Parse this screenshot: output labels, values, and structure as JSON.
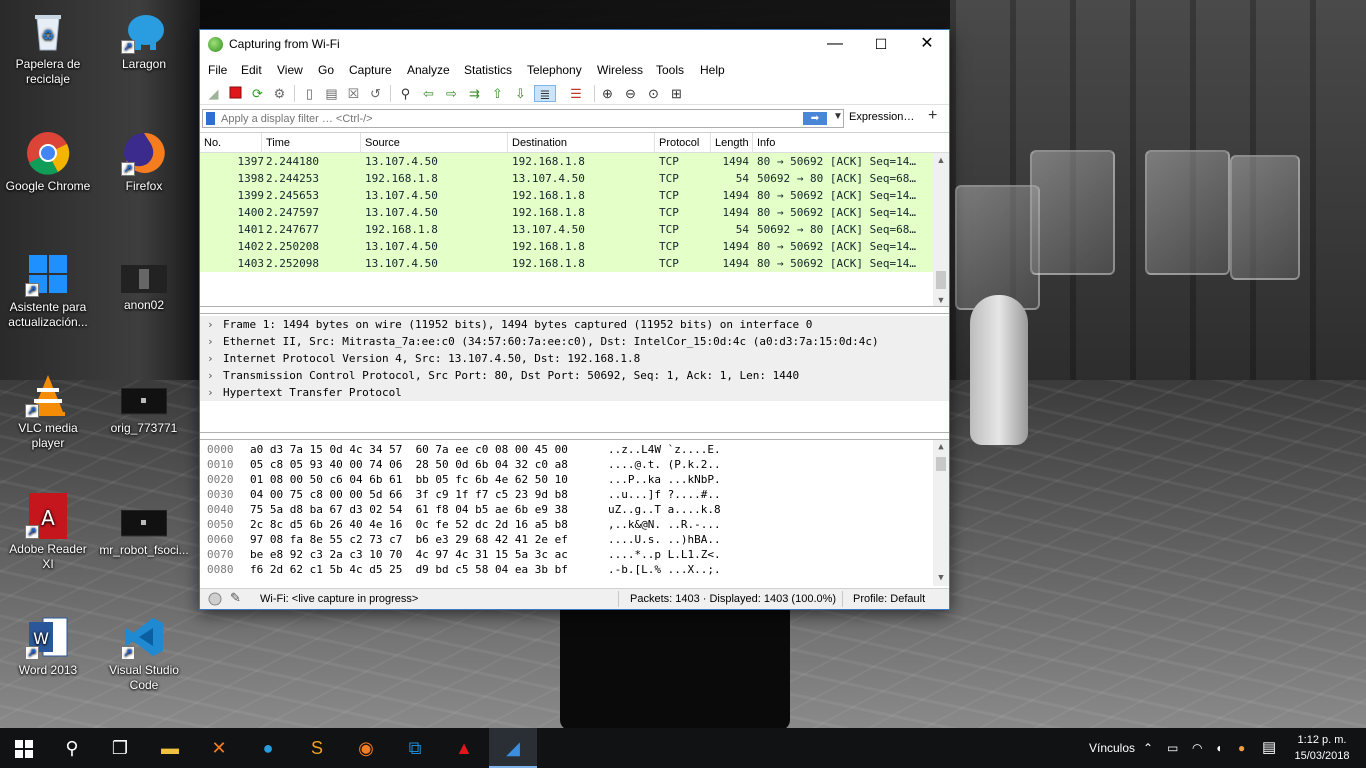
{
  "desktop": {
    "icons": [
      {
        "label": "Papelera de reciclaje",
        "icon": "recycle-bin-icon"
      },
      {
        "label": "Laragon",
        "icon": "laragon-icon"
      },
      {
        "label": "Google Chrome",
        "icon": "chrome-icon"
      },
      {
        "label": "Firefox",
        "icon": "firefox-icon"
      },
      {
        "label": "Asistente para actualización...",
        "icon": "windows-update-icon"
      },
      {
        "label": "anon02",
        "icon": "image-file-icon"
      },
      {
        "label": "VLC media player",
        "icon": "vlc-icon"
      },
      {
        "label": "orig_773771",
        "icon": "image-file-icon"
      },
      {
        "label": "Adobe Reader XI",
        "icon": "adobe-reader-icon"
      },
      {
        "label": "mr_robot_fsoci...",
        "icon": "image-file-icon"
      },
      {
        "label": "Word 2013",
        "icon": "word-icon"
      },
      {
        "label": "Visual Studio Code",
        "icon": "vscode-icon"
      }
    ]
  },
  "window": {
    "title": "Capturing from Wi-Fi",
    "controls": {
      "minimize": "—",
      "maximize": "☐",
      "close": "✕"
    }
  },
  "menu": [
    "File",
    "Edit",
    "View",
    "Go",
    "Capture",
    "Analyze",
    "Statistics",
    "Telephony",
    "Wireless",
    "Tools",
    "Help"
  ],
  "filter": {
    "placeholder": "Apply a display filter … <Ctrl-/>",
    "apply_symbol": "➡",
    "expression_label": "Expression…",
    "add_label": "+"
  },
  "packet_list": {
    "columns": [
      "No.",
      "Time",
      "Source",
      "Destination",
      "Protocol",
      "Length",
      "Info"
    ],
    "rows": [
      {
        "no": "1397",
        "time": "2.244180",
        "src": "13.107.4.50",
        "dst": "192.168.1.8",
        "proto": "TCP",
        "len": "1494",
        "info": "80 → 50692 [ACK] Seq=14…"
      },
      {
        "no": "1398",
        "time": "2.244253",
        "src": "192.168.1.8",
        "dst": "13.107.4.50",
        "proto": "TCP",
        "len": "54",
        "info": "50692 → 80 [ACK] Seq=68…"
      },
      {
        "no": "1399",
        "time": "2.245653",
        "src": "13.107.4.50",
        "dst": "192.168.1.8",
        "proto": "TCP",
        "len": "1494",
        "info": "80 → 50692 [ACK] Seq=14…"
      },
      {
        "no": "1400",
        "time": "2.247597",
        "src": "13.107.4.50",
        "dst": "192.168.1.8",
        "proto": "TCP",
        "len": "1494",
        "info": "80 → 50692 [ACK] Seq=14…"
      },
      {
        "no": "1401",
        "time": "2.247677",
        "src": "192.168.1.8",
        "dst": "13.107.4.50",
        "proto": "TCP",
        "len": "54",
        "info": "50692 → 80 [ACK] Seq=68…"
      },
      {
        "no": "1402",
        "time": "2.250208",
        "src": "13.107.4.50",
        "dst": "192.168.1.8",
        "proto": "TCP",
        "len": "1494",
        "info": "80 → 50692 [ACK] Seq=14…"
      },
      {
        "no": "1403",
        "time": "2.252098",
        "src": "13.107.4.50",
        "dst": "192.168.1.8",
        "proto": "TCP",
        "len": "1494",
        "info": "80 → 50692 [ACK] Seq=14…"
      }
    ],
    "row_color": "#e4ffc7"
  },
  "details": [
    "Frame 1: 1494 bytes on wire (11952 bits), 1494 bytes captured (11952 bits) on interface 0",
    "Ethernet II, Src: Mitrasta_7a:ee:c0 (34:57:60:7a:ee:c0), Dst: IntelCor_15:0d:4c (a0:d3:7a:15:0d:4c)",
    "Internet Protocol Version 4, Src: 13.107.4.50, Dst: 192.168.1.8",
    "Transmission Control Protocol, Src Port: 80, Dst Port: 50692, Seq: 1, Ack: 1, Len: 1440",
    "Hypertext Transfer Protocol"
  ],
  "hex": [
    {
      "offset": "0000",
      "bytes": "a0 d3 7a 15 0d 4c 34 57  60 7a ee c0 08 00 45 00",
      "ascii": "..z..L4W `z....E."
    },
    {
      "offset": "0010",
      "bytes": "05 c8 05 93 40 00 74 06  28 50 0d 6b 04 32 c0 a8",
      "ascii": "....@.t. (P.k.2.."
    },
    {
      "offset": "0020",
      "bytes": "01 08 00 50 c6 04 6b 61  bb 05 fc 6b 4e 62 50 10",
      "ascii": "...P..ka ...kNbP."
    },
    {
      "offset": "0030",
      "bytes": "04 00 75 c8 00 00 5d 66  3f c9 1f f7 c5 23 9d b8",
      "ascii": "..u...]f ?....#.."
    },
    {
      "offset": "0040",
      "bytes": "75 5a d8 ba 67 d3 02 54  61 f8 04 b5 ae 6b e9 38",
      "ascii": "uZ..g..T a....k.8"
    },
    {
      "offset": "0050",
      "bytes": "2c 8c d5 6b 26 40 4e 16  0c fe 52 dc 2d 16 a5 b8",
      "ascii": ",..k&@N. ..R.-..."
    },
    {
      "offset": "0060",
      "bytes": "97 08 fa 8e 55 c2 73 c7  b6 e3 29 68 42 41 2e ef",
      "ascii": "....U.s. ..)hBA.."
    },
    {
      "offset": "0070",
      "bytes": "be e8 92 c3 2a c3 10 70  4c 97 4c 31 15 5a 3c ac",
      "ascii": "....*..p L.L1.Z<."
    },
    {
      "offset": "0080",
      "bytes": "f6 2d 62 c1 5b 4c d5 25  d9 bd c5 58 04 ea 3b bf",
      "ascii": ".-b.[L.% ...X..;."
    }
  ],
  "status": {
    "capture": "Wi-Fi: <live capture in progress>",
    "packets": "Packets: 1403 · Displayed: 1403 (100.0%)",
    "profile": "Profile: Default"
  },
  "taskbar": {
    "vinculos": "Vínculos",
    "time": "1:12 p. m.",
    "date": "15/03/2018"
  }
}
